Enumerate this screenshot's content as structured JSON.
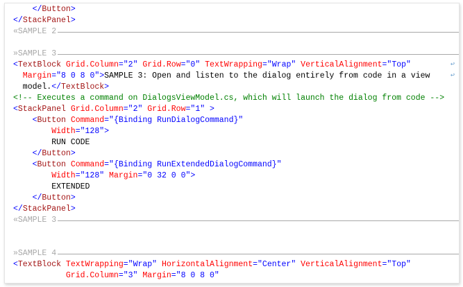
{
  "colors": {
    "tag": "#a31515",
    "delimiter": "#0000ff",
    "attribute": "#ff0000",
    "value": "#0000ff",
    "comment": "#008000",
    "region": "#a8a8a8"
  },
  "lines": [
    {
      "indent": 4,
      "tokens": [
        [
          "d",
          "</"
        ],
        [
          "t",
          "Button"
        ],
        [
          "d",
          ">"
        ]
      ]
    },
    {
      "indent": 0,
      "tokens": [
        [
          "d",
          "</"
        ],
        [
          "t",
          "StackPanel"
        ],
        [
          "d",
          ">"
        ]
      ]
    },
    {
      "region": "«SAMPLE 2"
    },
    {
      "blank": true
    },
    {
      "region": "»SAMPLE 3"
    },
    {
      "indent": 0,
      "wrap": true,
      "tokens": [
        [
          "d",
          "<"
        ],
        [
          "t",
          "TextBlock"
        ],
        [
          "a",
          " Grid.Column"
        ],
        [
          "d",
          "=\""
        ],
        [
          "v",
          "2"
        ],
        [
          "d",
          "\""
        ],
        [
          "a",
          " Grid.Row"
        ],
        [
          "d",
          "=\""
        ],
        [
          "v",
          "0"
        ],
        [
          "d",
          "\""
        ],
        [
          "a",
          " TextWrapping"
        ],
        [
          "d",
          "=\""
        ],
        [
          "v",
          "Wrap"
        ],
        [
          "d",
          "\""
        ],
        [
          "a",
          " VerticalAlignment"
        ],
        [
          "d",
          "=\""
        ],
        [
          "v",
          "Top"
        ],
        [
          "d",
          "\""
        ]
      ]
    },
    {
      "indent": 2,
      "wrap": true,
      "tokens": [
        [
          "a",
          "Margin"
        ],
        [
          "d",
          "=\""
        ],
        [
          "v",
          "8 0 8 0"
        ],
        [
          "d",
          "\">"
        ],
        [
          "x",
          "SAMPLE 3: Open and listen to the dialog entirely from code in a view"
        ]
      ]
    },
    {
      "indent": 2,
      "tokens": [
        [
          "x",
          "model."
        ],
        [
          "d",
          "</"
        ],
        [
          "t",
          "TextBlock"
        ],
        [
          "d",
          ">"
        ]
      ]
    },
    {
      "indent": 0,
      "tokens": [
        [
          "c",
          "<!-- Executes a command on DialogsViewModel.cs, which will launch the dialog from code -->"
        ]
      ]
    },
    {
      "indent": 0,
      "tokens": [
        [
          "d",
          "<"
        ],
        [
          "t",
          "StackPanel"
        ],
        [
          "a",
          " Grid.Column"
        ],
        [
          "d",
          "=\""
        ],
        [
          "v",
          "2"
        ],
        [
          "d",
          "\""
        ],
        [
          "a",
          " Grid.Row"
        ],
        [
          "d",
          "=\""
        ],
        [
          "v",
          "1"
        ],
        [
          "d",
          "\" >"
        ]
      ]
    },
    {
      "indent": 4,
      "tokens": [
        [
          "d",
          "<"
        ],
        [
          "t",
          "Button"
        ],
        [
          "a",
          " Command"
        ],
        [
          "d",
          "=\""
        ],
        [
          "v",
          "{Binding RunDialogCommand}"
        ],
        [
          "d",
          "\""
        ]
      ]
    },
    {
      "indent": 8,
      "tokens": [
        [
          "a",
          "Width"
        ],
        [
          "d",
          "=\""
        ],
        [
          "v",
          "128"
        ],
        [
          "d",
          "\">"
        ]
      ]
    },
    {
      "indent": 8,
      "tokens": [
        [
          "x",
          "RUN CODE"
        ]
      ]
    },
    {
      "indent": 4,
      "tokens": [
        [
          "d",
          "</"
        ],
        [
          "t",
          "Button"
        ],
        [
          "d",
          ">"
        ]
      ]
    },
    {
      "indent": 4,
      "tokens": [
        [
          "d",
          "<"
        ],
        [
          "t",
          "Button"
        ],
        [
          "a",
          " Command"
        ],
        [
          "d",
          "=\""
        ],
        [
          "v",
          "{Binding RunExtendedDialogCommand}"
        ],
        [
          "d",
          "\""
        ]
      ]
    },
    {
      "indent": 8,
      "tokens": [
        [
          "a",
          "Width"
        ],
        [
          "d",
          "=\""
        ],
        [
          "v",
          "128"
        ],
        [
          "d",
          "\""
        ],
        [
          "a",
          " Margin"
        ],
        [
          "d",
          "=\""
        ],
        [
          "v",
          "0 32 0 0"
        ],
        [
          "d",
          "\">"
        ]
      ]
    },
    {
      "indent": 8,
      "tokens": [
        [
          "x",
          "EXTENDED"
        ]
      ]
    },
    {
      "indent": 4,
      "tokens": [
        [
          "d",
          "</"
        ],
        [
          "t",
          "Button"
        ],
        [
          "d",
          ">"
        ]
      ]
    },
    {
      "indent": 0,
      "tokens": [
        [
          "d",
          "</"
        ],
        [
          "t",
          "StackPanel"
        ],
        [
          "d",
          ">"
        ]
      ]
    },
    {
      "region": "«SAMPLE 3"
    },
    {
      "blank": true
    },
    {
      "blank": true
    },
    {
      "region": "»SAMPLE 4"
    },
    {
      "indent": 0,
      "tokens": [
        [
          "d",
          "<"
        ],
        [
          "t",
          "TextBlock"
        ],
        [
          "a",
          " TextWrapping"
        ],
        [
          "d",
          "=\""
        ],
        [
          "v",
          "Wrap"
        ],
        [
          "d",
          "\""
        ],
        [
          "a",
          " HorizontalAlignment"
        ],
        [
          "d",
          "=\""
        ],
        [
          "v",
          "Center"
        ],
        [
          "d",
          "\""
        ],
        [
          "a",
          " VerticalAlignment"
        ],
        [
          "d",
          "=\""
        ],
        [
          "v",
          "Top"
        ],
        [
          "d",
          "\""
        ]
      ]
    },
    {
      "indent": 11,
      "tokens": [
        [
          "a",
          "Grid.Column"
        ],
        [
          "d",
          "=\""
        ],
        [
          "v",
          "3"
        ],
        [
          "d",
          "\""
        ],
        [
          "a",
          " Margin"
        ],
        [
          "d",
          "=\""
        ],
        [
          "v",
          "8 0 8 0"
        ],
        [
          "d",
          "\""
        ]
      ]
    }
  ],
  "wrap_glyph": "↩"
}
